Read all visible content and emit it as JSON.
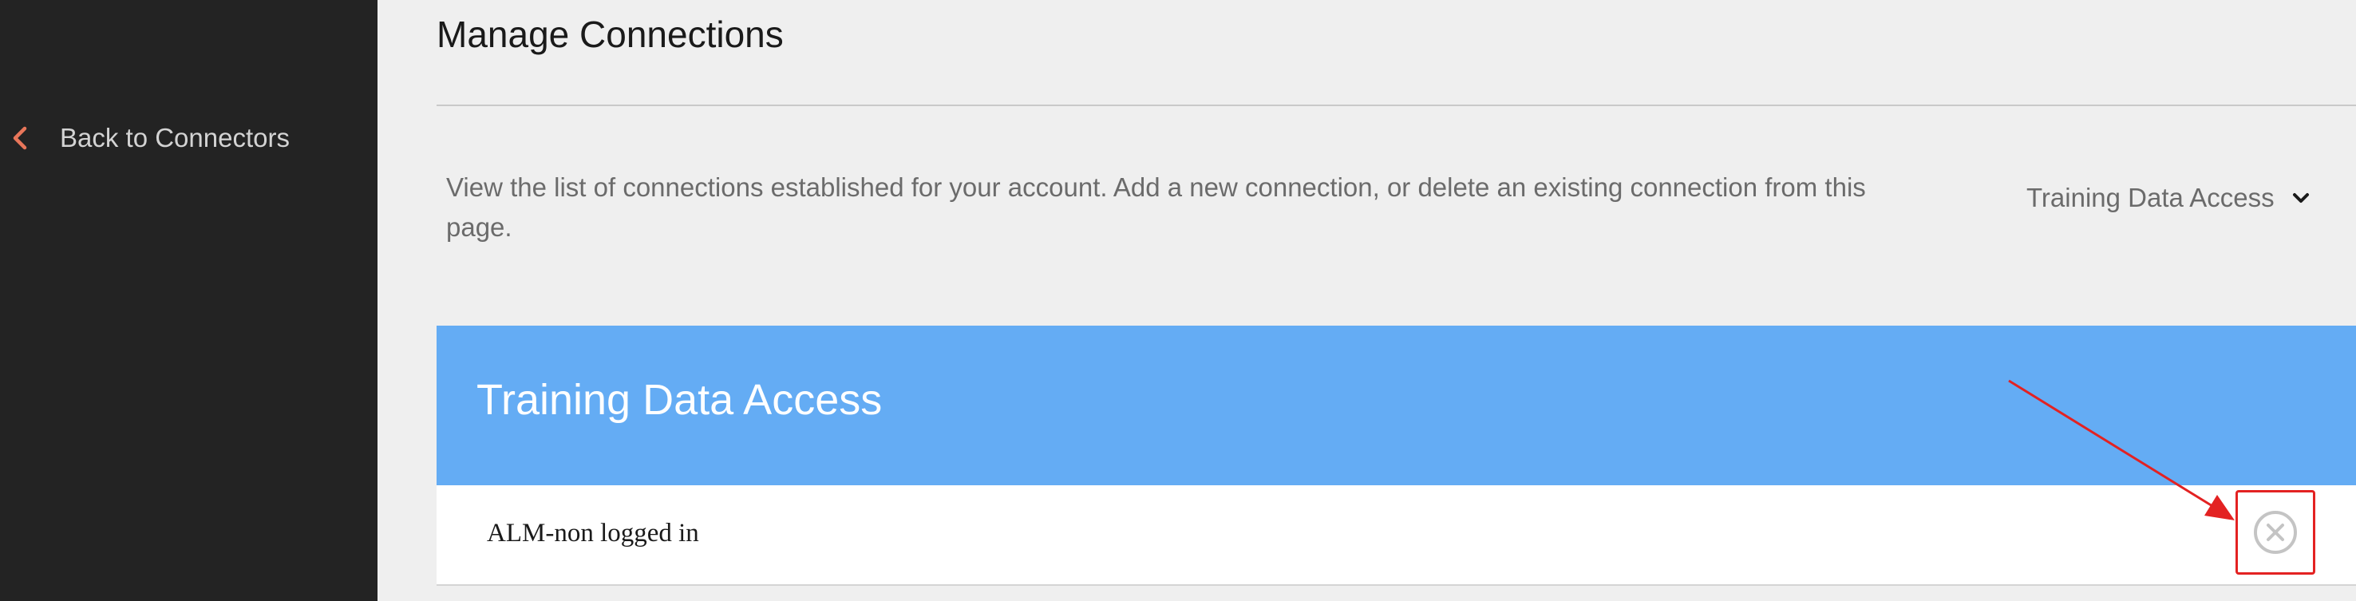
{
  "sidebar": {
    "back_label": "Back to Connectors",
    "back_icon": "chevron-left-icon"
  },
  "main": {
    "title": "Manage Connections",
    "description": "View the list of connections established for your account. Add a new connection, or delete an existing connection from this page.",
    "account_select": {
      "selected": "Training Data Access",
      "icon": "chevron-down-icon"
    },
    "card": {
      "title": "Training Data Access",
      "connections": [
        {
          "name": "ALM-non logged in",
          "delete_icon": "close-circle-icon"
        }
      ]
    }
  },
  "colors": {
    "sidebar_bg": "#232323",
    "page_bg": "#efefef",
    "card_header_bg": "#64acf4",
    "back_icon": "#e8765a",
    "annotation_red": "#e32222"
  }
}
